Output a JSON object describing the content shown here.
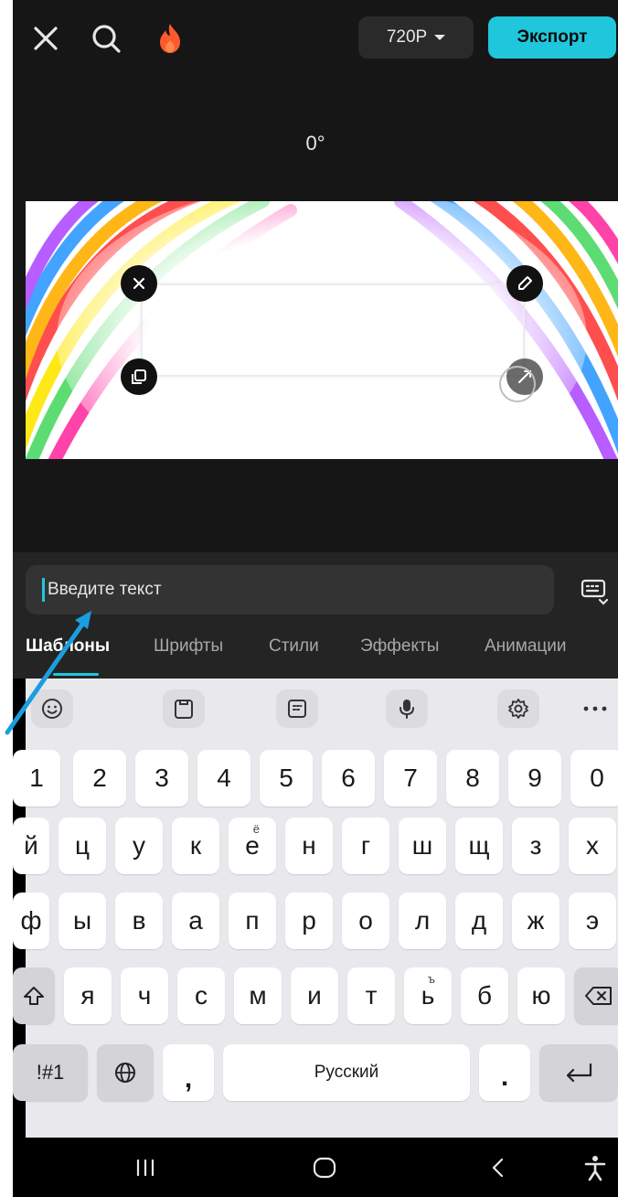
{
  "topbar": {
    "resolution": "720P",
    "export_label": "Экспорт"
  },
  "preview": {
    "rotation": "0°"
  },
  "text_panel": {
    "placeholder": "Введите текст",
    "tabs": [
      {
        "label": "Шаблоны",
        "active": true
      },
      {
        "label": "Шрифты",
        "active": false
      },
      {
        "label": "Стили",
        "active": false
      },
      {
        "label": "Эффекты",
        "active": false
      },
      {
        "label": "Анимации",
        "active": false
      }
    ]
  },
  "keyboard": {
    "toolbar_icons": [
      "emoji-icon",
      "clipboard-icon",
      "sticker-icon",
      "mic-icon",
      "settings-icon",
      "more-icon"
    ],
    "numbers": [
      "1",
      "2",
      "3",
      "4",
      "5",
      "6",
      "7",
      "8",
      "9",
      "0"
    ],
    "row1": [
      "й",
      "ц",
      "у",
      "к",
      "е",
      "н",
      "г",
      "ш",
      "щ",
      "з",
      "х"
    ],
    "row1_alt": {
      "е": "ё"
    },
    "row2": [
      "ф",
      "ы",
      "в",
      "а",
      "п",
      "р",
      "о",
      "л",
      "д",
      "ж",
      "э"
    ],
    "row3": [
      "я",
      "ч",
      "с",
      "м",
      "и",
      "т",
      "ь",
      "б",
      "ю"
    ],
    "row3_alt": {
      "ь": "ъ"
    },
    "symbols_label": "!#1",
    "comma": ",",
    "space_label": "Русский",
    "period": "."
  },
  "colors": {
    "accent": "#20c7dc",
    "annotation_arrow": "#1a9ee0"
  }
}
